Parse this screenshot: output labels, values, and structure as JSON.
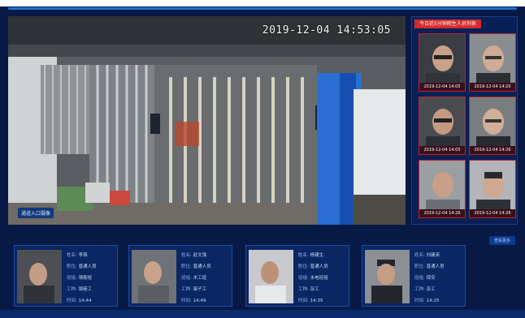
{
  "video": {
    "timestamp": "2019-12-04 14:53:05",
    "camera_label": "通道入口摄像"
  },
  "alert": {
    "title": "今日近5分钟陌生人员列表",
    "faces": [
      {
        "time": "2019-12-04 14:05"
      },
      {
        "time": "2019-12-04 14:20"
      },
      {
        "time": "2019-12-04 14:05"
      },
      {
        "time": "2019-12-04 14:26"
      },
      {
        "time": "2019-12-04 14:26"
      },
      {
        "time": "2019-12-04 14:26"
      }
    ]
  },
  "more_label": "查看更多",
  "cards": [
    {
      "name": "李燕",
      "role": "普通人员",
      "team": "钢筋班",
      "trade": "钢筋工",
      "time": "14:44"
    },
    {
      "name": "赵文强",
      "role": "普通人员",
      "team": "木工班",
      "trade": "架子工",
      "time": "14:49"
    },
    {
      "name": "杨建生",
      "role": "普通人员",
      "team": "水电班组",
      "trade": "杂工",
      "time": "14:35"
    },
    {
      "name": "刘建英",
      "role": "普通人员",
      "team": "保安",
      "trade": "杂工",
      "time": "14:25"
    }
  ],
  "labels": {
    "name": "姓名:",
    "role": "职位:",
    "team": "班组:",
    "trade": "工种:",
    "time": "时间:"
  }
}
